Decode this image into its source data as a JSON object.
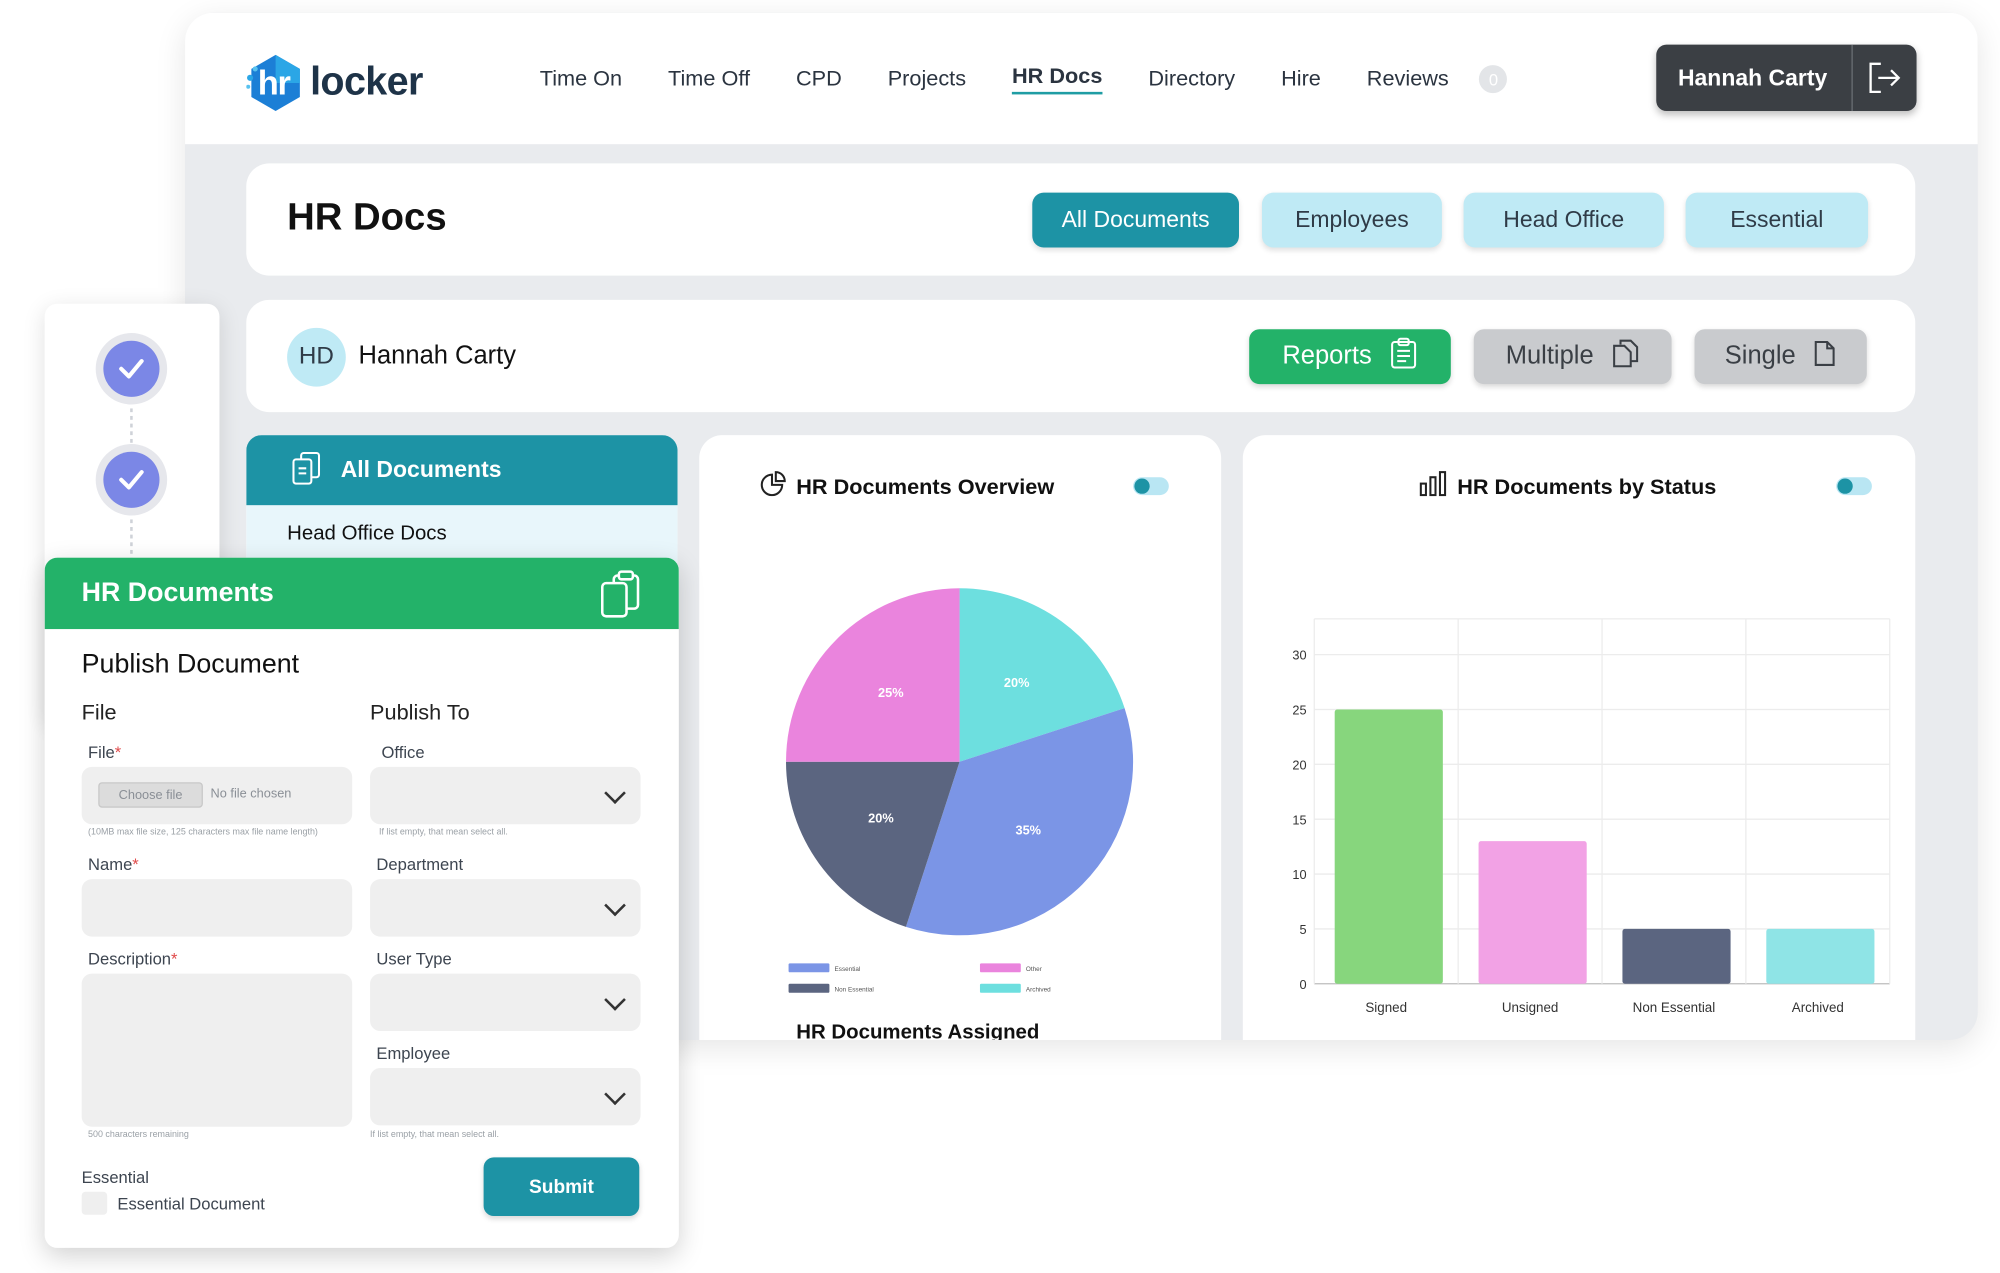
{
  "brand": {
    "logo_prefix": "hr",
    "logo_suffix": "locker"
  },
  "nav": {
    "items": [
      "Time On",
      "Time Off",
      "CPD",
      "Projects",
      "HR Docs",
      "Directory",
      "Hire",
      "Reviews"
    ],
    "active": "HR Docs",
    "notification_count": "0"
  },
  "user": {
    "name": "Hannah Carty",
    "initials": "HD"
  },
  "page": {
    "title": "HR Docs",
    "filters": [
      "All Documents",
      "Employees",
      "Head Office",
      "Essential"
    ],
    "active_filter": "All Documents"
  },
  "actions": {
    "reports": "Reports",
    "multiple": "Multiple",
    "single": "Single"
  },
  "docs_menu": {
    "header": "All Documents",
    "items": [
      "Head Office Docs"
    ]
  },
  "overview": {
    "title": "HR Documents Overview",
    "toggle": "On",
    "next_title": "HR Documents Assigned"
  },
  "status": {
    "title": "HR Documents by Status",
    "toggle": "On"
  },
  "chart_data": [
    {
      "type": "pie",
      "title": "HR Documents Overview",
      "slices": [
        {
          "label": "Other",
          "value": 20,
          "text": "20%",
          "color": "#6ddfdf"
        },
        {
          "label": "Essential",
          "value": 35,
          "text": "35%",
          "color": "#7b95e6"
        },
        {
          "label": "Non Essential",
          "value": 20,
          "text": "20%",
          "color": "#5b6580"
        },
        {
          "label": "",
          "value": 25,
          "text": "25%",
          "color": "#ea84dd"
        }
      ],
      "legend": [
        {
          "label": "Essential",
          "color": "#7b95e6"
        },
        {
          "label": "Other",
          "color": "#ea84dd"
        },
        {
          "label": "Non Essential",
          "color": "#5b6580"
        },
        {
          "label": "Archived",
          "color": "#6ddfdf"
        }
      ],
      "legend_position": "bottom"
    },
    {
      "type": "bar",
      "title": "HR Documents by Status",
      "categories": [
        "Signed",
        "Unsigned",
        "Non Essential",
        "Archived"
      ],
      "values": [
        25,
        13,
        5,
        5
      ],
      "colors": [
        "#87d67d",
        "#f2a2e5",
        "#5b6580",
        "#8fe4e6"
      ],
      "ylim": [
        0,
        30
      ],
      "yticks": [
        0,
        5,
        10,
        15,
        20,
        25,
        30
      ],
      "grid": true
    }
  ],
  "form": {
    "header": "HR Documents",
    "title": "Publish Document",
    "section_file": "File",
    "section_publish": "Publish To",
    "file_label": "File",
    "choose_file": "Choose file",
    "no_file": "No file chosen",
    "file_hint": "(10MB max file size, 125 characters max file name length)",
    "name_label": "Name",
    "description_label": "Description",
    "description_hint": "500 characters remaining",
    "office_label": "Office",
    "office_hint": "If list empty, that mean select all.",
    "department_label": "Department",
    "user_type_label": "User Type",
    "employee_label": "Employee",
    "employee_hint": "If list empty, that mean select all.",
    "essential_label": "Essential",
    "essential_checkbox": "Essential Document",
    "submit": "Submit",
    "required_mark": "*"
  },
  "colors": {
    "teal": "#1d93a5",
    "green": "#23b269",
    "light_teal": "#bfeaf5",
    "dark": "#3b3f44"
  }
}
